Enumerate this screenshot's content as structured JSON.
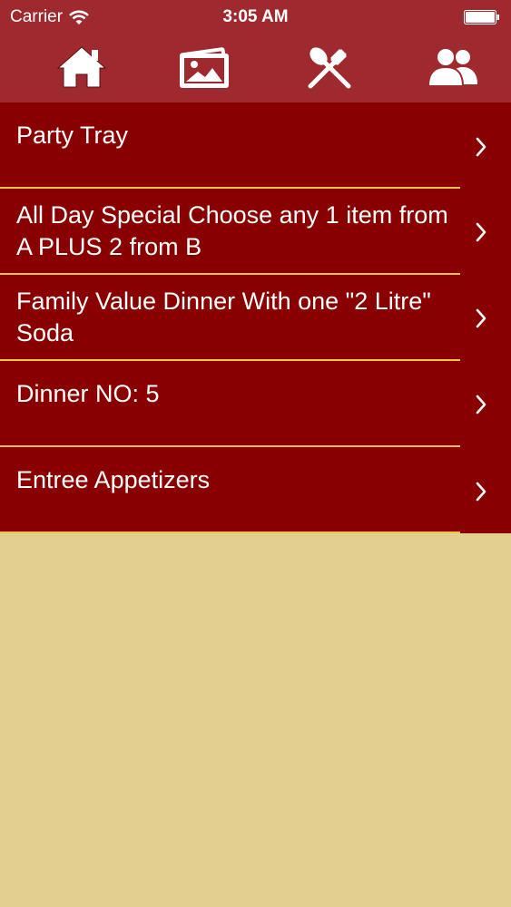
{
  "status_bar": {
    "carrier": "Carrier",
    "time": "3:05 AM"
  },
  "toolbar": {
    "buttons": [
      {
        "icon": "home-icon"
      },
      {
        "icon": "gallery-icon"
      },
      {
        "icon": "fork-spoon-icon"
      },
      {
        "icon": "users-icon"
      }
    ]
  },
  "menu": {
    "items": [
      {
        "label": "Party Tray"
      },
      {
        "label": "All Day Special Choose any 1 item from A PLUS 2 from B"
      },
      {
        "label": "Family Value Dinner With one \"2 Litre\" Soda"
      },
      {
        "label": "Dinner NO: 5"
      },
      {
        "label": "Entree Appetizers"
      }
    ]
  },
  "colors": {
    "header": "#9e2a2f",
    "list_background": "#880000",
    "divider": "#f2c44a",
    "page_background": "#e3cf8f"
  }
}
